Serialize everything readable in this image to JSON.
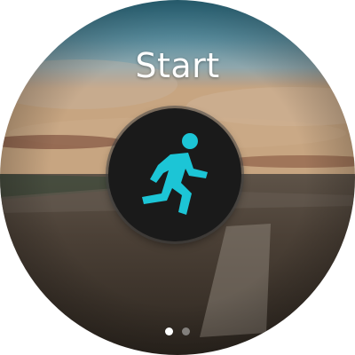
{
  "screen": {
    "title": "Start"
  },
  "start_button": {
    "icon": "running-person-icon",
    "icon_color": "#1cc5d6"
  },
  "page_indicator": {
    "pages": 2,
    "current": 1
  }
}
